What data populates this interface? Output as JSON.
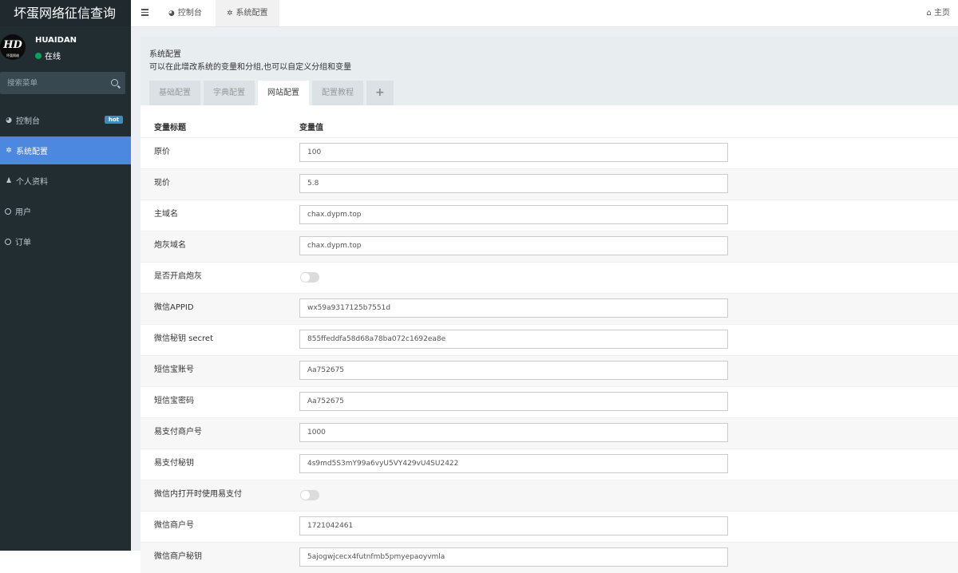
{
  "app": {
    "brand": "坏蛋网络征信查询",
    "avatar_text": "HD",
    "avatar_caption": "坏蛋网络",
    "user_name": "HUAIDAN",
    "user_status": "在线",
    "search_placeholder": "搜索菜单"
  },
  "sidebar": {
    "items": [
      {
        "label": "控制台",
        "icon": "dashboard-icon",
        "badge": "hot"
      },
      {
        "label": "系统配置",
        "icon": "gear-icon",
        "active": true
      },
      {
        "label": "个人资料",
        "icon": "user-icon"
      },
      {
        "label": "用户",
        "icon": "circle-icon"
      },
      {
        "label": "订单",
        "icon": "circle-icon"
      }
    ]
  },
  "topbar": {
    "tabs": [
      {
        "label": "控制台",
        "icon": "dashboard-icon"
      },
      {
        "label": "系统配置",
        "icon": "gear-icon",
        "active": true
      }
    ],
    "home_label": "主页"
  },
  "panel": {
    "title": "系统配置",
    "description": "可以在此增改系统的变量和分组,也可以自定义分组和变量",
    "subtabs": [
      "基础配置",
      "字典配置",
      "网站配置",
      "配置教程",
      "+"
    ],
    "active_subtab": "网站配置",
    "columns": [
      "变量标题",
      "变量值"
    ],
    "rows": [
      {
        "label": "原价",
        "type": "input",
        "value": "100"
      },
      {
        "label": "现价",
        "type": "input",
        "value": "5.8"
      },
      {
        "label": "主域名",
        "type": "input",
        "value": "chax.dypm.top"
      },
      {
        "label": "炮灰域名",
        "type": "input",
        "value": "chax.dypm.top"
      },
      {
        "label": "是否开启炮灰",
        "type": "toggle",
        "value": "off"
      },
      {
        "label": "微信APPID",
        "type": "input",
        "value": "wx59a9317125b7551d"
      },
      {
        "label": "微信秘钥 secret",
        "type": "input",
        "value": "855ffeddfa58d68a78ba072c1692ea8e"
      },
      {
        "label": "短信宝账号",
        "type": "input",
        "value": "Aa752675"
      },
      {
        "label": "短信宝密码",
        "type": "input",
        "value": "Aa752675"
      },
      {
        "label": "易支付商户号",
        "type": "input",
        "value": "1000"
      },
      {
        "label": "易支付秘钥",
        "type": "input",
        "value": "4s9md5S3mY99a6vyU5VY429vU4SU2422"
      },
      {
        "label": "微信内打开时使用易支付",
        "type": "toggle",
        "value": "off"
      },
      {
        "label": "微信商户号",
        "type": "input",
        "value": "1721042461"
      },
      {
        "label": "微信商户秘钥",
        "type": "input",
        "value": "5ajogwjcecx4futnfmb5pmyepaoyvmla"
      }
    ]
  },
  "colors": {
    "sidebar_bg": "#222d32",
    "sidebar_active": "#4c87e0",
    "online_dot": "#00a65a",
    "badge_bg": "#3c8dbc",
    "content_bg": "#ecf0f5"
  }
}
